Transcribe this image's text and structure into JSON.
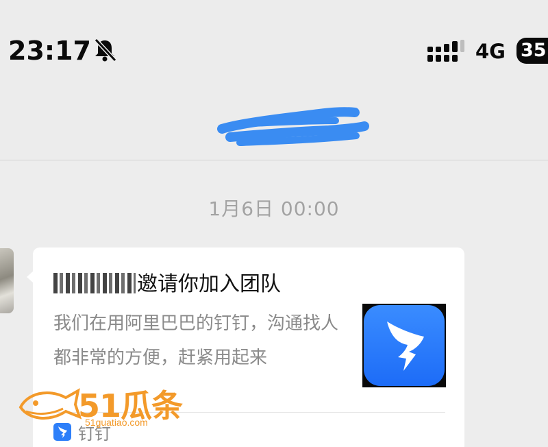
{
  "status_bar": {
    "time": "23:17",
    "network": "4G",
    "battery_level": "35",
    "icons": [
      "bell-slash-icon",
      "signal-bars-icon",
      "battery-icon"
    ]
  },
  "header": {
    "title_redacted": true
  },
  "chat": {
    "timestamp": "1月6日 00:00",
    "message_card": {
      "title": "邀请你加入团队",
      "description": "我们在用阿里巴巴的钉钉，沟通找人都非常的方便，赶紧用起来",
      "app_icon": "dingtalk-logo-icon",
      "source_label": "钉钉"
    }
  },
  "watermark": {
    "text": "51瓜条",
    "url": "51guatiao.com"
  },
  "colors": {
    "background": "#ededed",
    "card": "#ffffff",
    "dingtalk_blue": "#1d6cf7",
    "watermark_orange": "#f39a2a",
    "timestamp_gray": "#a3a3a3"
  }
}
